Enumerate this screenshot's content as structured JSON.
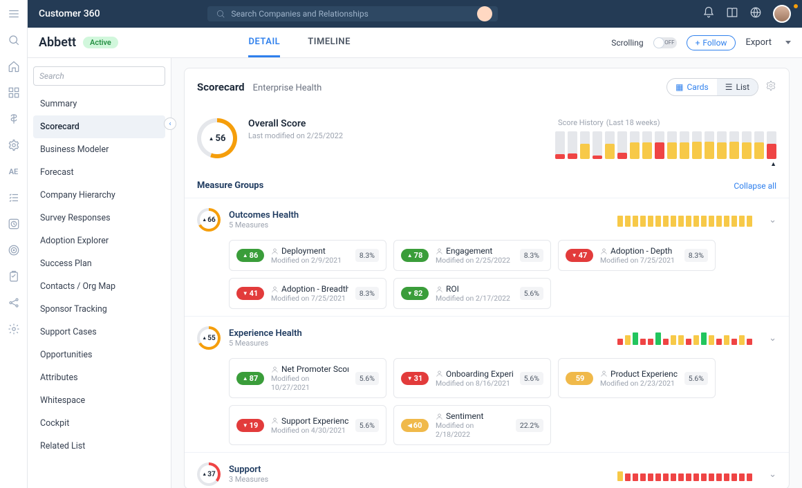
{
  "app_title": "Customer 360",
  "search_placeholder": "Search Companies and Relationships",
  "company": {
    "name": "Abbett",
    "status": "Active"
  },
  "tabs": {
    "detail": "DETAIL",
    "timeline": "TIMELINE"
  },
  "actions": {
    "scrolling": "Scrolling",
    "toggle": "OFF",
    "follow": "Follow",
    "export": "Export"
  },
  "side_search_placeholder": "Search",
  "nav": [
    "Summary",
    "Scorecard",
    "Business Modeler",
    "Forecast",
    "Company Hierarchy",
    "Survey Responses",
    "Adoption Explorer",
    "Success Plan",
    "Contacts / Org Map",
    "Sponsor Tracking",
    "Support Cases",
    "Opportunities",
    "Attributes",
    "Whitespace",
    "Cockpit",
    "Related List"
  ],
  "scorecard": {
    "title": "Scorecard",
    "subtitle": "Enterprise Health",
    "views": {
      "cards": "Cards",
      "list": "List"
    },
    "overall": {
      "label": "Overall Score",
      "value": "56",
      "modified": "Last modified on 2/25/2022"
    },
    "history": {
      "label": "Score History",
      "range": "(Last 18 weeks)"
    },
    "measure_groups_label": "Measure Groups",
    "collapse_all": "Collapse all",
    "groups": [
      {
        "name": "Outcomes Health",
        "count": "5 Measures",
        "score": "66",
        "ring": "amber",
        "measures": [
          {
            "pill": "86",
            "color": "green",
            "arr": "▲",
            "name": "Deployment",
            "mod": "Modified on 2/9/2021",
            "pct": "8.3%"
          },
          {
            "pill": "78",
            "color": "green",
            "arr": "▲",
            "name": "Engagement",
            "mod": "Modified on 2/25/2022",
            "pct": "8.3%"
          },
          {
            "pill": "47",
            "color": "red",
            "arr": "▼",
            "name": "Adoption - Depth",
            "mod": "Modified on 7/25/2021",
            "pct": "8.3%"
          },
          {
            "pill": "41",
            "color": "red",
            "arr": "▼",
            "name": "Adoption - Breadth",
            "mod": "Modified on 7/25/2021",
            "pct": "8.3%"
          },
          {
            "pill": "82",
            "color": "green",
            "arr": "▼",
            "name": "ROI",
            "mod": "Modified on 2/17/2022",
            "pct": "5.6%"
          }
        ]
      },
      {
        "name": "Experience Health",
        "count": "5 Measures",
        "score": "55",
        "ring": "amber",
        "measures": [
          {
            "pill": "87",
            "color": "green",
            "arr": "▲",
            "name": "Net Promoter Score",
            "mod": "Modified on 10/27/2021",
            "pct": "5.6%"
          },
          {
            "pill": "31",
            "color": "red",
            "arr": "▼",
            "name": "Onboarding Experi...",
            "mod": "Modified on 8/16/2021",
            "pct": "5.6%"
          },
          {
            "pill": "59",
            "color": "amber",
            "arr": "",
            "name": "Product Experience",
            "mod": "Modified on 2/23/2021",
            "pct": "5.6%"
          },
          {
            "pill": "19",
            "color": "red",
            "arr": "▼",
            "name": "Support Experience",
            "mod": "Modified on 4/30/2021",
            "pct": "5.6%"
          },
          {
            "pill": "60",
            "color": "amber",
            "arr": "◀",
            "name": "Sentiment",
            "mod": "Modified on 2/18/2022",
            "pct": "22.2%"
          }
        ]
      },
      {
        "name": "Support",
        "count": "3 Measures",
        "score": "37",
        "ring": "red",
        "measures": []
      }
    ]
  },
  "chart_data": {
    "type": "bar",
    "title": "Score History",
    "categories_note": "Last 18 weeks",
    "ylim": [
      0,
      100
    ],
    "series": [
      {
        "name": "overall",
        "colors": [
          "red",
          "red",
          "amber",
          "red",
          "amber",
          "red",
          "amber",
          "amber",
          "red",
          "amber",
          "amber",
          "amber",
          "amber",
          "amber",
          "amber",
          "amber",
          "amber",
          "red"
        ],
        "values": [
          18,
          20,
          55,
          12,
          55,
          22,
          60,
          60,
          60,
          60,
          60,
          62,
          62,
          60,
          62,
          60,
          60,
          55
        ]
      }
    ],
    "group_sparklines": {
      "Outcomes Health": {
        "colors": [
          "amber",
          "amber",
          "amber",
          "amber",
          "amber",
          "amber",
          "amber",
          "amber",
          "amber",
          "amber",
          "amber",
          "amber",
          "amber",
          "amber",
          "amber",
          "amber",
          "amber",
          "amber"
        ],
        "values": [
          66,
          66,
          66,
          66,
          66,
          66,
          66,
          66,
          66,
          66,
          66,
          66,
          66,
          66,
          66,
          66,
          66,
          66
        ]
      },
      "Experience Health": {
        "colors": [
          "red",
          "amber",
          "green",
          "red",
          "red",
          "green",
          "red",
          "amber",
          "amber",
          "red",
          "amber",
          "green",
          "amber",
          "red",
          "amber",
          "red",
          "amber",
          "red"
        ],
        "values": [
          30,
          55,
          80,
          30,
          30,
          80,
          30,
          55,
          55,
          30,
          55,
          80,
          55,
          30,
          55,
          30,
          55,
          30
        ]
      },
      "Support": {
        "colors": [
          "amber",
          "red",
          "red",
          "red",
          "red",
          "red",
          "red",
          "red",
          "red",
          "red",
          "red",
          "red",
          "red",
          "red",
          "red",
          "red",
          "red",
          "red"
        ],
        "values": [
          55,
          37,
          37,
          37,
          37,
          37,
          37,
          37,
          37,
          37,
          37,
          37,
          37,
          37,
          37,
          37,
          37,
          37
        ]
      }
    }
  }
}
